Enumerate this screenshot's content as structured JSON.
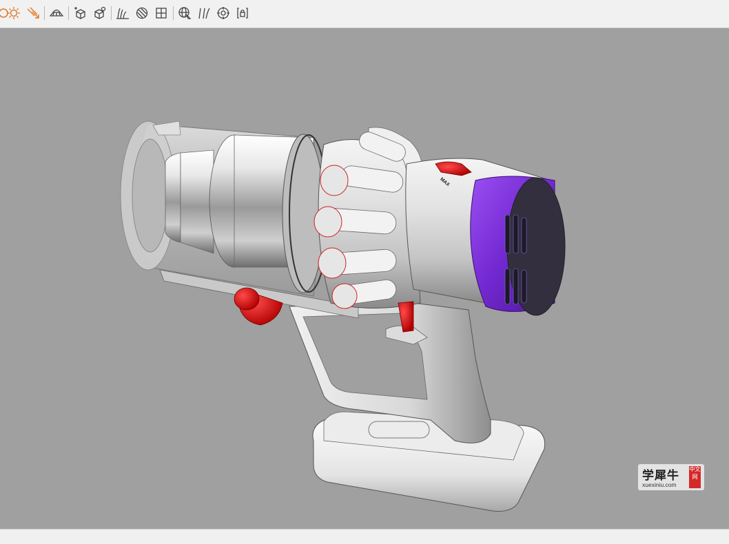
{
  "toolbar": {
    "icons": [
      "sun-partial-icon",
      "sun-icon",
      "directional-light-icon",
      "ground-plane-icon",
      "add-box-icon",
      "box-settings-icon",
      "environment-icon",
      "material-icon",
      "split-view-icon",
      "globe-cursor-icon",
      "curves-icon",
      "target-icon",
      "lock-frame-icon"
    ]
  },
  "viewport": {
    "background_color": "#a0a0a0",
    "model": "cordless-vacuum-handheld"
  },
  "colors": {
    "accent_orange": "#e07a2e",
    "toolbar_icon": "#444444",
    "body_gray": "#d6d6d6",
    "trigger_red": "#e01010",
    "motor_purple": "#7a2fd0"
  },
  "watermark": {
    "title": "学犀牛",
    "url": "xuexiniu.com",
    "badge": "中文网"
  }
}
